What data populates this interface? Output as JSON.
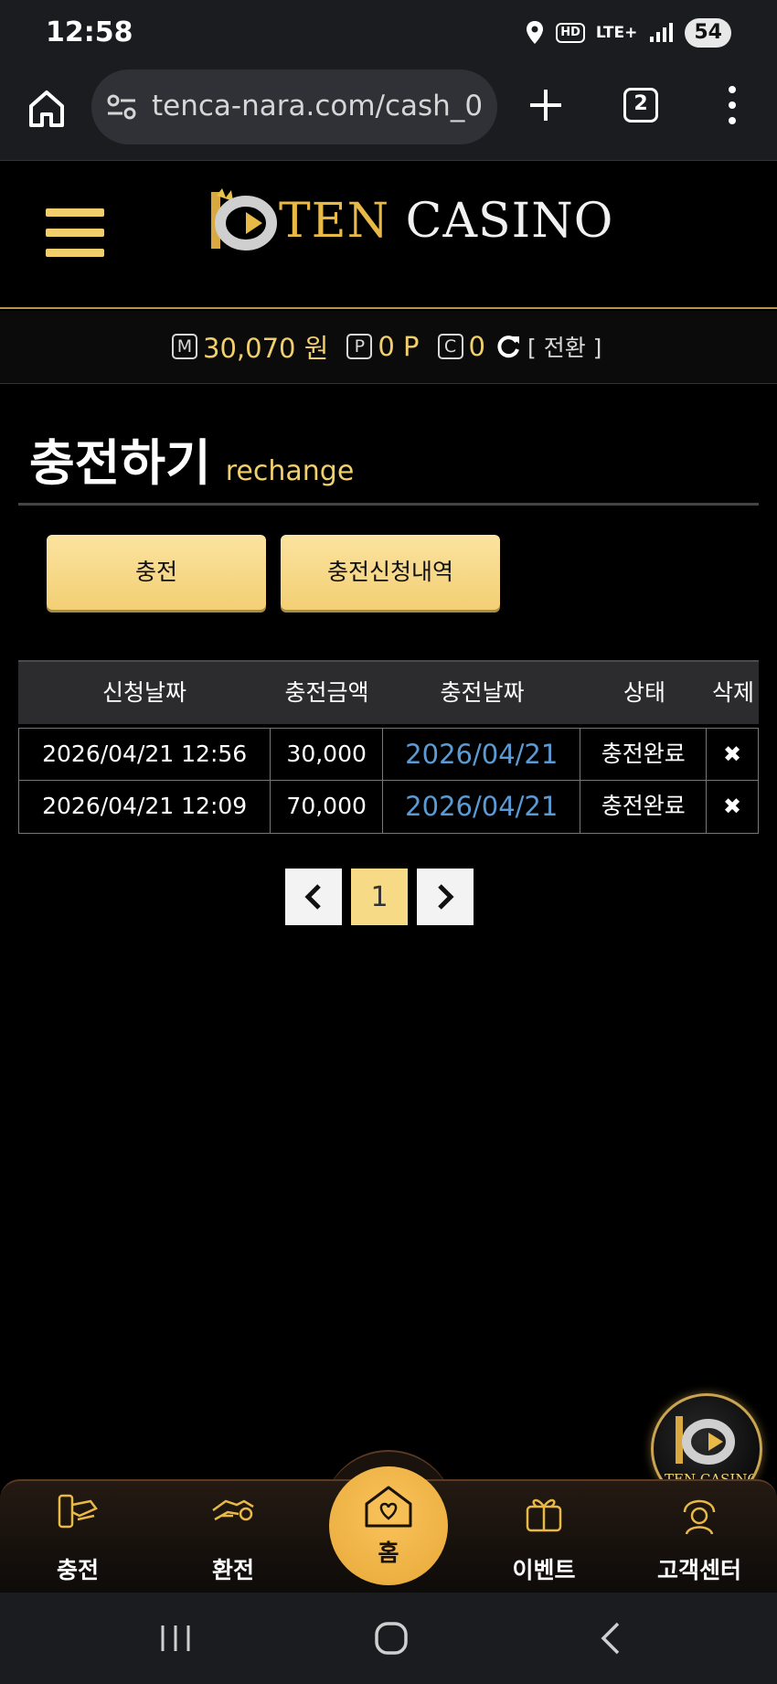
{
  "status": {
    "time": "12:58",
    "hd": "HD",
    "network": "LTE+",
    "battery": "54"
  },
  "browser": {
    "url": "tenca-nara.com/cash_0",
    "tab_count": "2"
  },
  "site": {
    "logo_ten": "TEN",
    "logo_casino": " CASINO"
  },
  "wallet": {
    "money_badge": "M",
    "money": "30,070 원",
    "point_badge": "P",
    "points": "0 P",
    "coin_badge": "C",
    "coins": "0",
    "switch_label": "[ 전환 ]"
  },
  "page": {
    "title": "충전하기",
    "subtitle": "rechange"
  },
  "tabs": {
    "charge": "충전",
    "history": "충전신청내역"
  },
  "table": {
    "headers": [
      "신청날짜",
      "충전금액",
      "충전날짜",
      "상태",
      "삭제"
    ],
    "rows": [
      {
        "request_date": "2026/04/21 12:56",
        "amount": "30,000",
        "charge_date": "2026/04/21",
        "status": "충전완료",
        "delete": "✖"
      },
      {
        "request_date": "2026/04/21 12:09",
        "amount": "70,000",
        "charge_date": "2026/04/21",
        "status": "충전완료",
        "delete": "✖"
      }
    ]
  },
  "pagination": {
    "prev": "‹",
    "current": "1",
    "next": "›"
  },
  "bottom_nav": {
    "charge": "충전",
    "exchange": "환전",
    "home": "홈",
    "event": "이벤트",
    "support": "고객센터"
  },
  "float_logo": {
    "text": "TEN CASINO"
  },
  "colors": {
    "accent_gold": "#f2cf6d",
    "link_blue": "#5b9bd5",
    "home_orange": "#e8a838"
  }
}
